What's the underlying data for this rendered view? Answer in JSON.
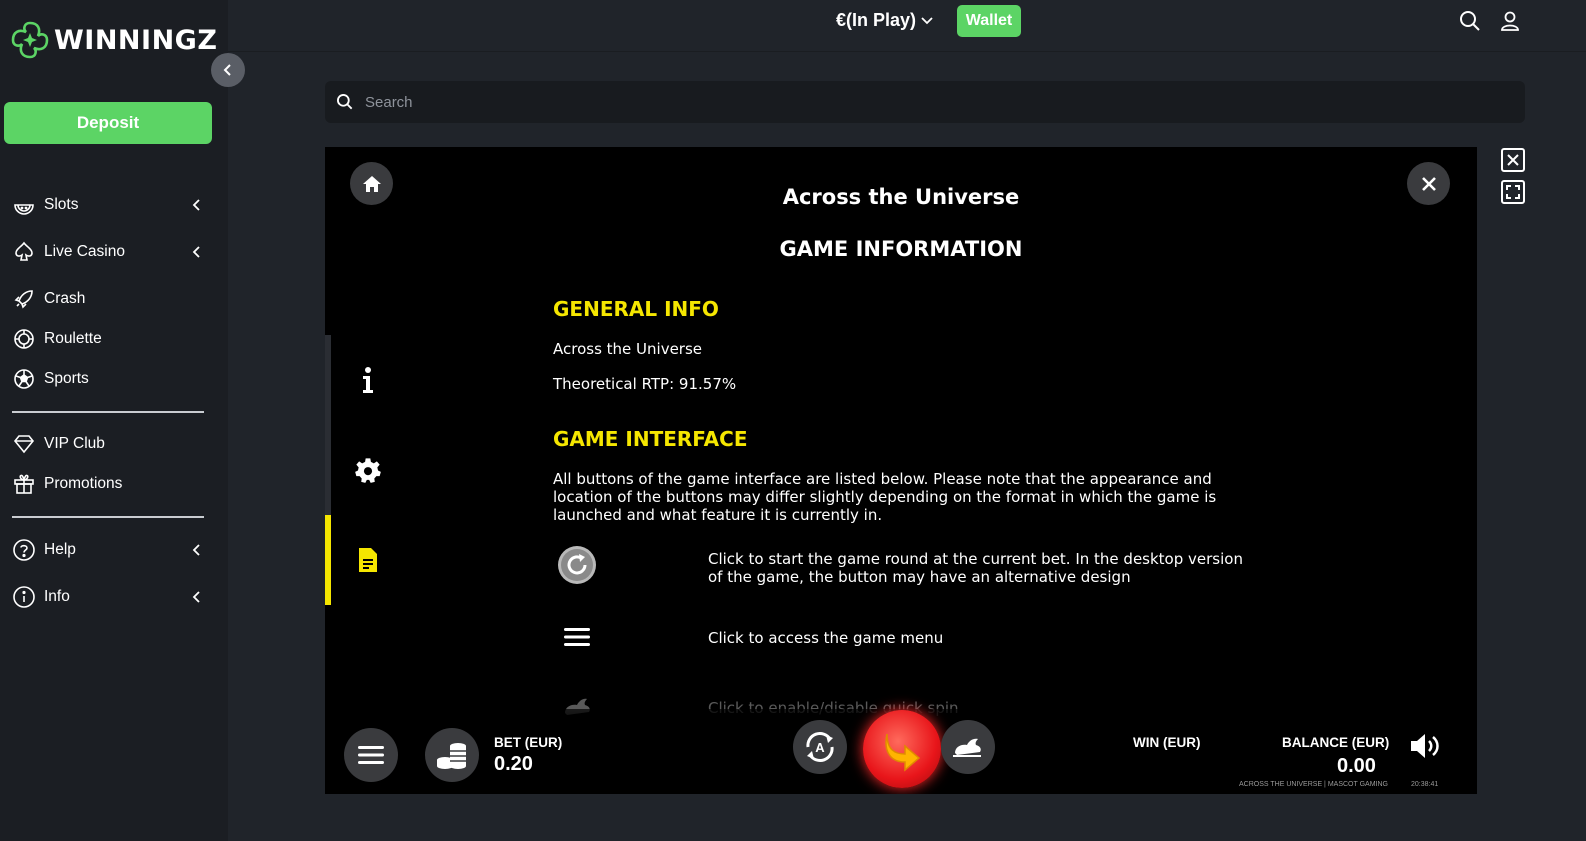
{
  "brand": {
    "name": "WINNINGZ",
    "accent": "#5cd465"
  },
  "sidebar": {
    "deposit_label": "Deposit",
    "items": [
      {
        "label": "Slots",
        "icon": "watermelon-icon",
        "expandable": true
      },
      {
        "label": "Live Casino",
        "icon": "spade-icon",
        "expandable": true
      },
      {
        "label": "Crash",
        "icon": "rocket-icon",
        "expandable": false
      },
      {
        "label": "Roulette",
        "icon": "roulette-icon",
        "expandable": false
      },
      {
        "label": "Sports",
        "icon": "soccer-ball-icon",
        "expandable": false
      },
      {
        "label": "VIP Club",
        "icon": "diamond-icon",
        "expandable": false
      },
      {
        "label": "Promotions",
        "icon": "gift-icon",
        "expandable": false
      },
      {
        "label": "Help",
        "icon": "question-icon",
        "expandable": true
      },
      {
        "label": "Info",
        "icon": "info-icon",
        "expandable": true
      }
    ]
  },
  "topbar": {
    "balance_label": "€(In Play)",
    "wallet_label": "Wallet"
  },
  "search": {
    "placeholder": "Search"
  },
  "game": {
    "title": "Across the Universe",
    "subtitle": "GAME INFORMATION",
    "general_info": {
      "heading": "GENERAL INFO",
      "name": "Across the Universe",
      "rtp": "Theoretical RTP: 91.57%"
    },
    "interface": {
      "heading": "GAME INTERFACE",
      "intro": "All buttons of the game interface are listed below. Please note that the appearance and location of the buttons may differ slightly depending on the format in which the game is launched and what feature it is currently in.",
      "rows": [
        {
          "icon": "spin-refresh-icon",
          "text": "Click to start the game round at the current bet. In the desktop version of the game, the button may have an alternative design"
        },
        {
          "icon": "menu-icon",
          "text": "Click to access the game menu"
        },
        {
          "icon": "rabbit-icon",
          "text": "Click to enable/disable quick spin"
        }
      ]
    },
    "bottom": {
      "bet_label": "BET (EUR)",
      "bet_value": "0.20",
      "win_label": "WIN (EUR)",
      "balance_label": "BALANCE (EUR)",
      "balance_value": "0.00",
      "footer": "ACROSS THE UNIVERSE | MASCOT GAMING",
      "time": "20:38:41"
    },
    "tab_colors": {
      "active": "#f5e600",
      "inactive": "#2a2d33"
    }
  }
}
